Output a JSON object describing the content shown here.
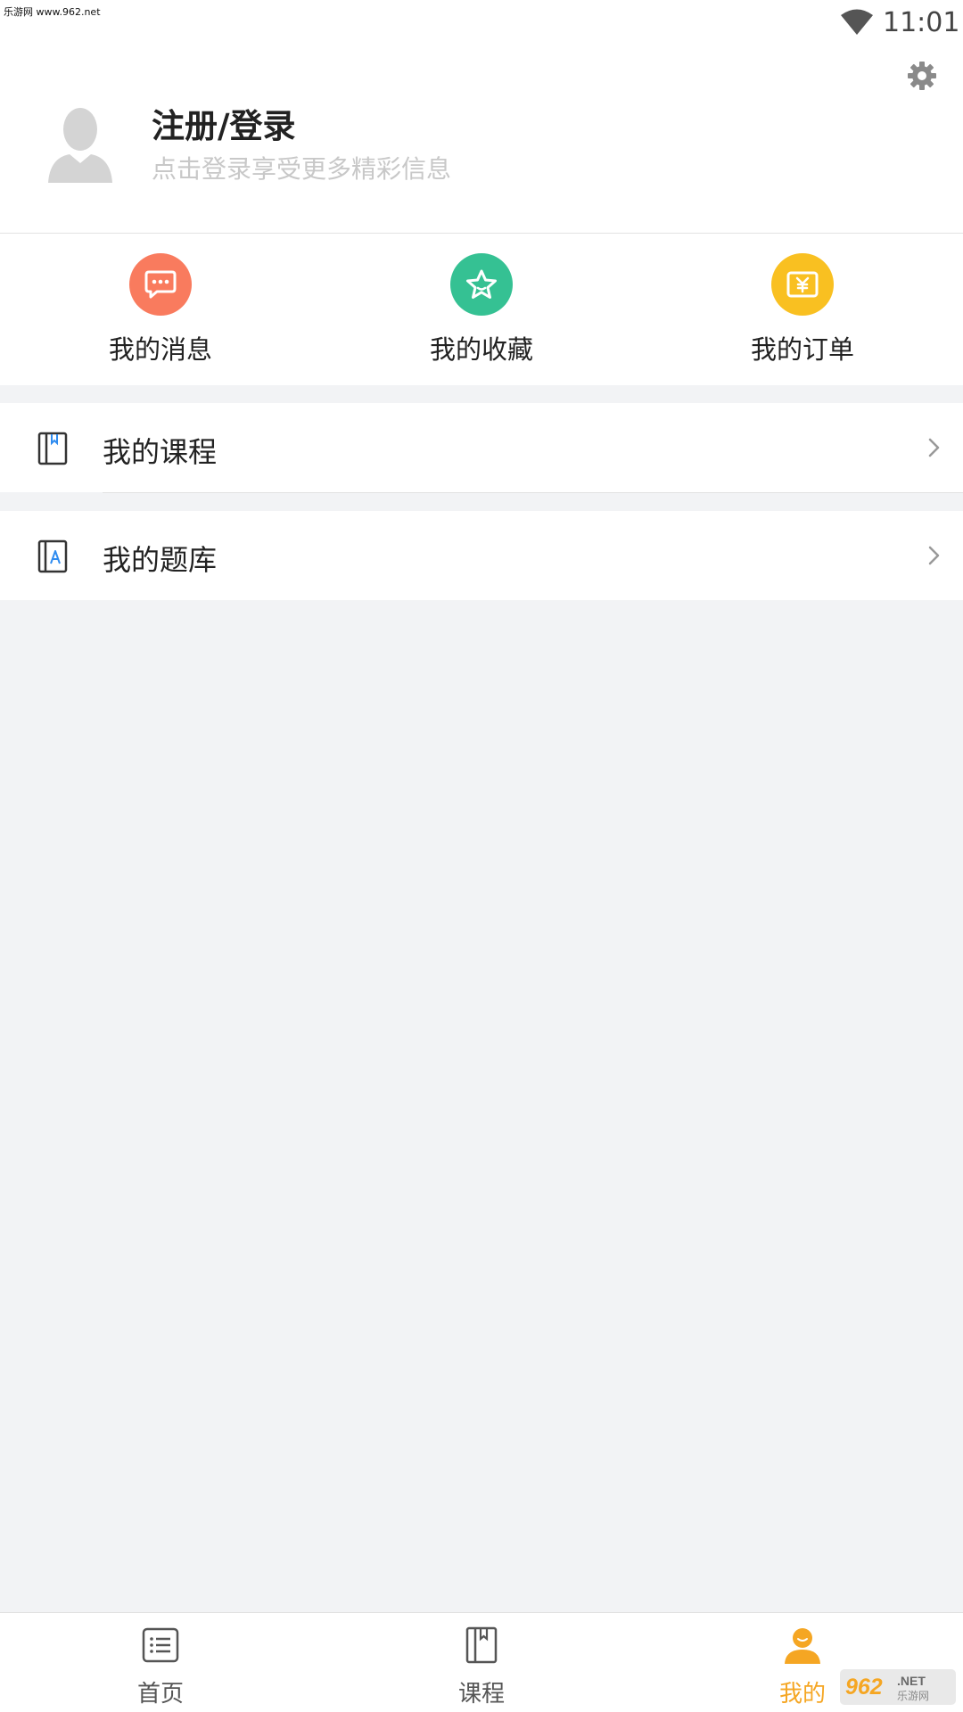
{
  "watermark": "乐游网 www.962.net",
  "status": {
    "time": "11:01"
  },
  "header": {
    "title": "注册/登录",
    "subtitle": "点击登录享受更多精彩信息"
  },
  "quick_actions": [
    {
      "label": "我的消息",
      "icon": "message-icon",
      "color": "#f97b5e"
    },
    {
      "label": "我的收藏",
      "icon": "star-icon",
      "color": "#35c193"
    },
    {
      "label": "我的订单",
      "icon": "yen-order-icon",
      "color": "#f9c021"
    }
  ],
  "menu": [
    {
      "label": "我的课程",
      "icon": "course-book-icon"
    },
    {
      "label": "我的题库",
      "icon": "question-bank-icon"
    }
  ],
  "bottom_nav": [
    {
      "label": "首页",
      "icon": "home-list-icon",
      "active": false
    },
    {
      "label": "课程",
      "icon": "course-book-icon",
      "active": false
    },
    {
      "label": "我的",
      "icon": "person-icon",
      "active": true
    }
  ],
  "colors": {
    "active": "#f5a623",
    "background": "#f2f3f5"
  },
  "bottom_watermark": {
    "text": "962",
    "net": ".NET",
    "sub": "乐游网"
  }
}
